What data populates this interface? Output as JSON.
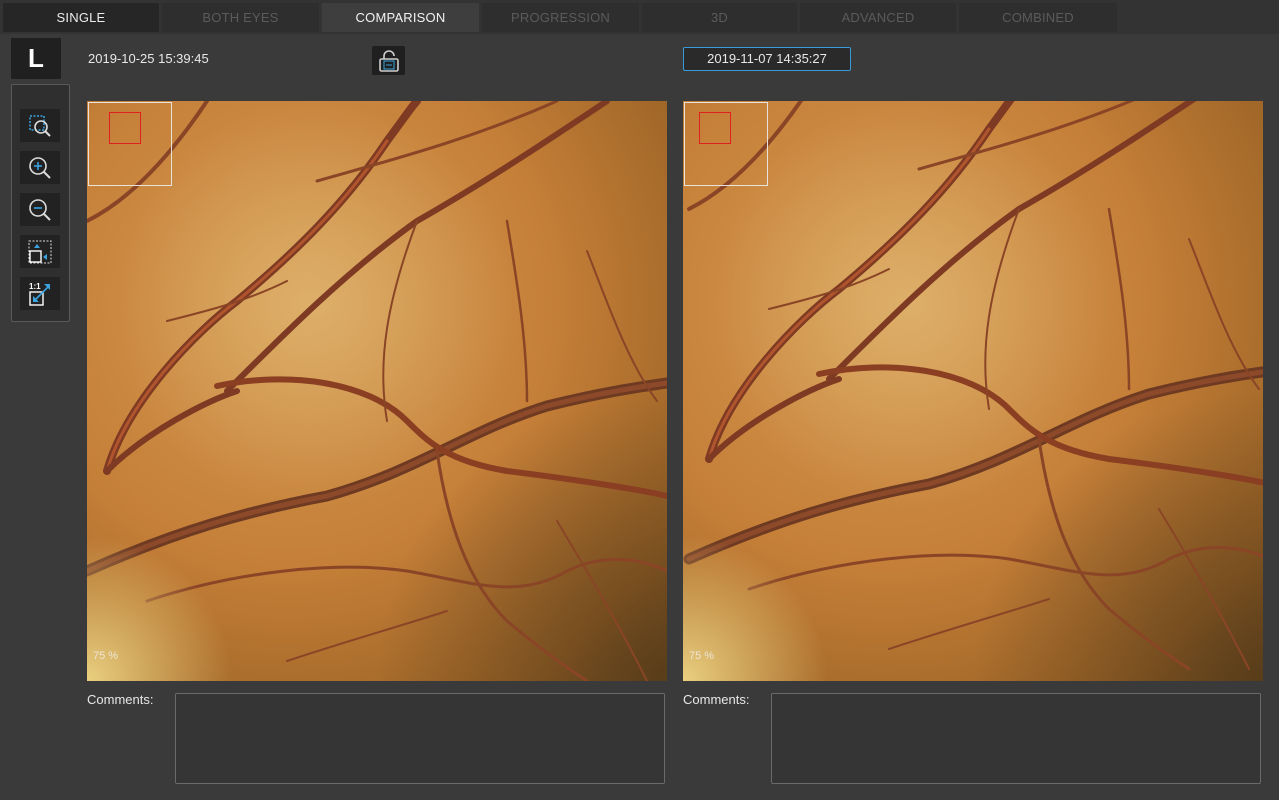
{
  "tabs": [
    {
      "label": "SINGLE",
      "state": "enabled"
    },
    {
      "label": "BOTH EYES",
      "state": "disabled"
    },
    {
      "label": "COMPARISON",
      "state": "active"
    },
    {
      "label": "PROGRESSION",
      "state": "disabled"
    },
    {
      "label": "3D",
      "state": "disabled"
    },
    {
      "label": "ADVANCED",
      "state": "disabled"
    },
    {
      "label": "COMBINED",
      "state": "disabled"
    }
  ],
  "eye": {
    "label": "L"
  },
  "toolbar": {
    "tools": [
      "zoom-region-icon",
      "zoom-in-icon",
      "zoom-out-icon",
      "fit-to-window-icon",
      "actual-size-icon"
    ]
  },
  "left_image": {
    "date": "2019-10-25 15:39:45",
    "zoom": "75 %",
    "comments_label": "Comments:",
    "comments_value": ""
  },
  "right_image": {
    "date": "2019-11-07 14:35:27",
    "zoom": "75 %",
    "comments_label": "Comments:",
    "comments_value": ""
  },
  "sync_lock": {
    "icon": "sync-lock-icon"
  },
  "colors": {
    "background": "#3a3a3a",
    "accent": "#3a9ad9",
    "viewport_marker": "#e02020",
    "fundus_base": "#c8843c"
  }
}
